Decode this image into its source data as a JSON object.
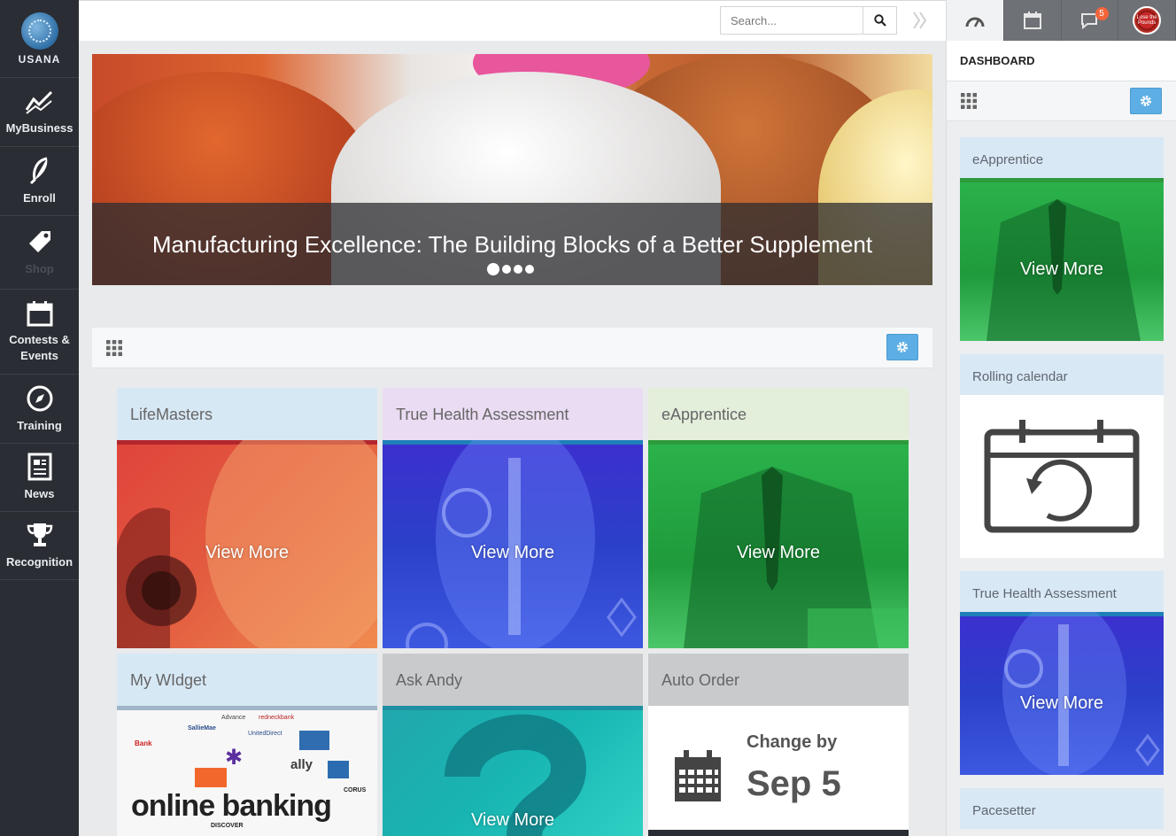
{
  "brand": {
    "name": "USANA"
  },
  "sidebar": {
    "items": [
      {
        "label": "MyBusiness",
        "icon": "chart-line-icon"
      },
      {
        "label": "Enroll",
        "icon": "feather-icon"
      },
      {
        "label": "Shop",
        "icon": "tag-icon"
      },
      {
        "label": "Contests & Events",
        "icon": "calendar-icon"
      },
      {
        "label": "Training",
        "icon": "compass-icon"
      },
      {
        "label": "News",
        "icon": "newspaper-icon"
      },
      {
        "label": "Recognition",
        "icon": "trophy-icon"
      }
    ]
  },
  "search": {
    "placeholder": "Search..."
  },
  "banner": {
    "caption": "Manufacturing Excellence: The Building Blocks of a Better Supplement",
    "slide_count": 4,
    "active_slide": 1
  },
  "tiles": [
    {
      "title": "LifeMasters",
      "action": "View More",
      "accent": "#d7e8f5"
    },
    {
      "title": "True Health Assessment",
      "action": "View More",
      "accent": "#eadcf3"
    },
    {
      "title": "eApprentice",
      "action": "View More",
      "accent": "#e3eedb"
    },
    {
      "title": "My WIdget",
      "action": "",
      "accent": "#d7e8f5",
      "image_text": "online banking",
      "logos": [
        "Advance",
        "redneckbank",
        "Bank",
        "SallieMae",
        "UnitedDirect",
        "ally",
        "DISCOVER",
        "CORUS"
      ]
    },
    {
      "title": "Ask Andy",
      "action": "View More",
      "accent": "#c9cacc"
    },
    {
      "title": "Auto Order",
      "accent": "#c9cacc",
      "change_label": "Change by",
      "change_date": "Sep 5"
    }
  ],
  "rightpanel": {
    "title": "DASHBOARD",
    "notification_count": "5",
    "avatar_text": "Lose the Pounds",
    "cards": [
      {
        "title": "eApprentice",
        "action": "View More"
      },
      {
        "title": "Rolling calendar"
      },
      {
        "title": "True Health Assessment",
        "action": "View More"
      },
      {
        "title": "Pacesetter"
      }
    ]
  },
  "colors": {
    "sidebar_bg": "#2a2d33",
    "gear_button": "#5daee4",
    "badge": "#f2653a"
  }
}
